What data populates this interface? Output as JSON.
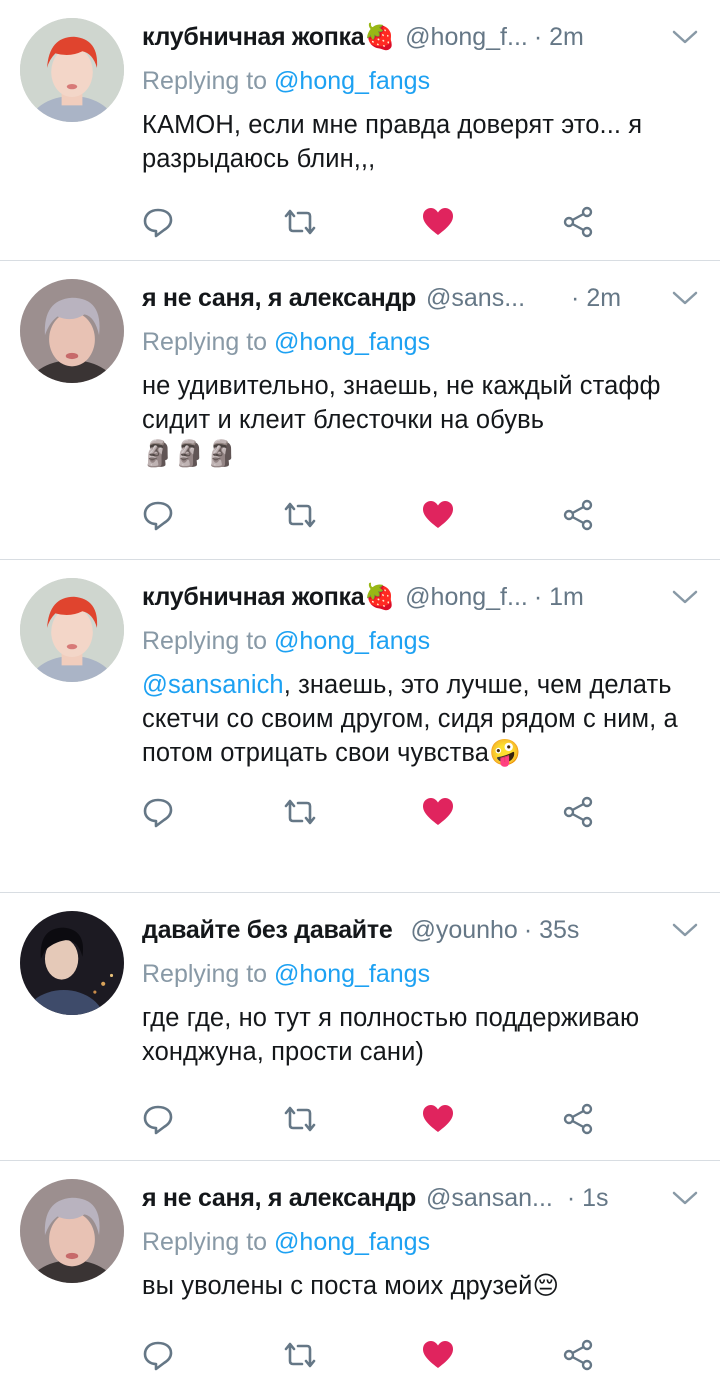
{
  "tweets": [
    {
      "name": "клубничная жопка🍓",
      "handle": "@hong_f...",
      "time": "· 2m",
      "replying_prefix": "Replying to ",
      "replying_to": "@hong_fangs",
      "mention": "",
      "text": "КАМОН, если мне правда доверят это... я разрыдаюсь блин,,,",
      "avatar": "red-haired-avatar",
      "liked": true
    },
    {
      "name": "я не саня, я александр",
      "handle": "@sans...",
      "time": "· 2m",
      "replying_prefix": "Replying to ",
      "replying_to": "@hong_fangs",
      "mention": "",
      "text": "не удивительно, знаешь, не каждый стафф сидит и клеит блесточки на обувь",
      "trailing_emoji": "🗿🗿🗿",
      "avatar": "grey-haired-avatar",
      "liked": true
    },
    {
      "name": "клубничная жопка🍓",
      "handle": "@hong_f...",
      "time": "· 1m",
      "replying_prefix": "Replying to ",
      "replying_to": "@hong_fangs",
      "mention": "@sansanich",
      "text": ", знаешь, это лучше, чем делать скетчи со своим другом, сидя рядом с ним, а потом отрицать свои чувства🤪",
      "avatar": "red-haired-avatar",
      "liked": true
    },
    {
      "name": "давайте без давайте",
      "handle": "@younho",
      "time": "· 35s",
      "replying_prefix": "Replying to ",
      "replying_to": "@hong_fangs",
      "mention": "",
      "text": "где где, но тут я полностью поддерживаю хонджуна, прости сани)",
      "avatar": "dark-night-avatar",
      "liked": true
    },
    {
      "name": "я не саня, я александр",
      "handle": "@sansan...",
      "time": "· 1s",
      "replying_prefix": "Replying to ",
      "replying_to": "@hong_fangs",
      "mention": "",
      "text": "вы уволены с поста моих друзей😔",
      "avatar": "grey-haired-avatar",
      "liked": true
    }
  ],
  "icons": {
    "reply": "reply-icon",
    "retweet": "retweet-icon",
    "like": "heart-icon",
    "share": "share-icon",
    "more": "chevron-down-icon"
  },
  "colors": {
    "accent": "#1da1f2",
    "like": "#e0245e",
    "muted": "#657786",
    "icon": "#657786"
  }
}
